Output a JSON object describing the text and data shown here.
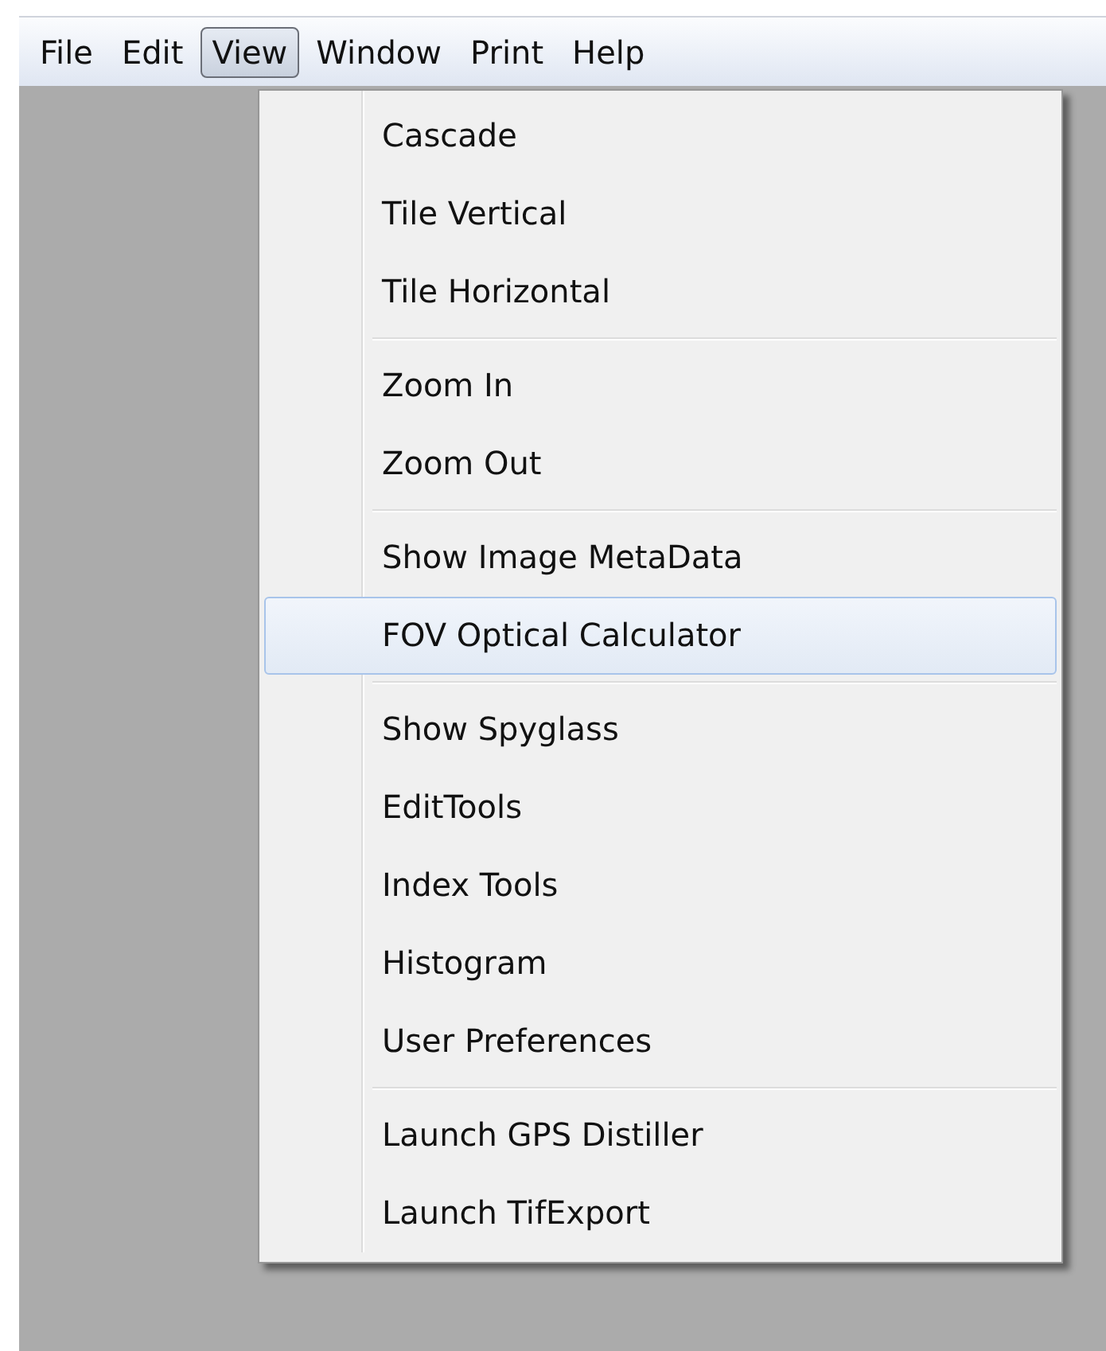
{
  "menubar": [
    {
      "label": "File",
      "selected": false
    },
    {
      "label": "Edit",
      "selected": false
    },
    {
      "label": "View",
      "selected": true
    },
    {
      "label": "Window",
      "selected": false
    },
    {
      "label": "Print",
      "selected": false
    },
    {
      "label": "Help",
      "selected": false
    }
  ],
  "menu": {
    "groups": [
      {
        "items": [
          {
            "label": "Cascade",
            "selected": false
          },
          {
            "label": "Tile Vertical",
            "selected": false
          },
          {
            "label": "Tile Horizontal",
            "selected": false
          }
        ]
      },
      {
        "items": [
          {
            "label": "Zoom In",
            "selected": false
          },
          {
            "label": "Zoom Out",
            "selected": false
          }
        ]
      },
      {
        "items": [
          {
            "label": "Show Image MetaData",
            "selected": false
          },
          {
            "label": "FOV Optical Calculator",
            "selected": true
          }
        ]
      },
      {
        "items": [
          {
            "label": "Show Spyglass",
            "selected": false
          },
          {
            "label": "EditTools",
            "selected": false
          },
          {
            "label": "Index Tools",
            "selected": false
          },
          {
            "label": "Histogram",
            "selected": false
          },
          {
            "label": "User Preferences",
            "selected": false
          }
        ]
      },
      {
        "items": [
          {
            "label": "Launch GPS Distiller",
            "selected": false
          },
          {
            "label": "Launch TifExport",
            "selected": false
          }
        ]
      }
    ]
  }
}
